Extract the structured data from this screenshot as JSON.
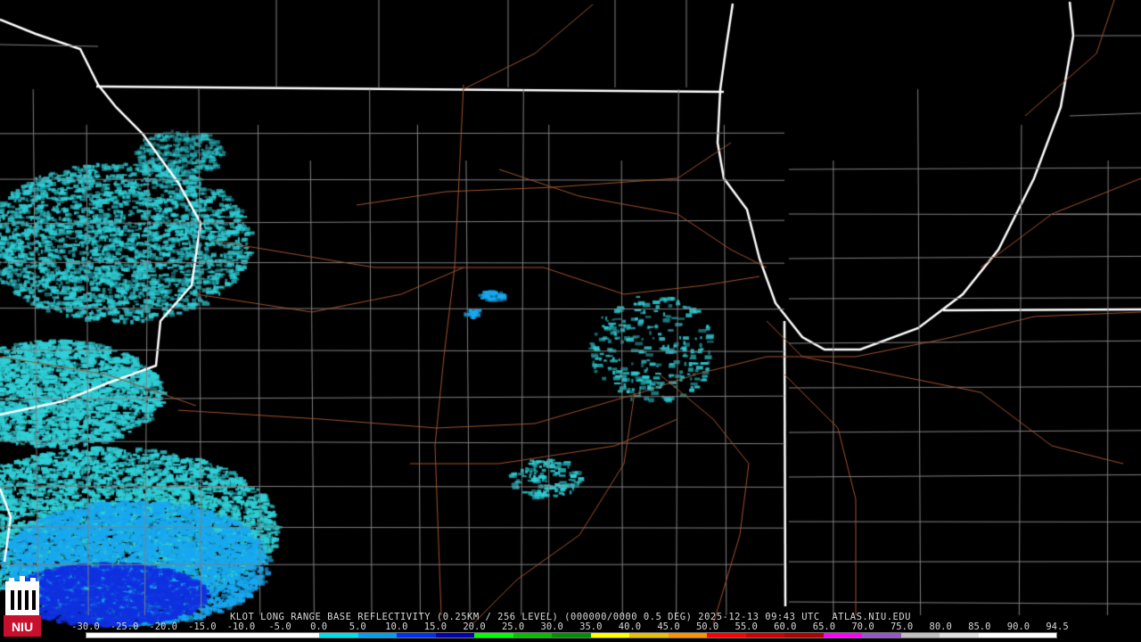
{
  "product": {
    "title_line": "KLOT LONG RANGE BASE REFLECTIVITY (0.25KM / 256 LEVEL) (000000/0000 0.5 DEG) 2025-12-13 09:43 UTC  ATLAS.NIU.EDU"
  },
  "colorbar": {
    "tick_labels": [
      "-30.0",
      "-25.0",
      "-20.0",
      "-15.0",
      "-10.0",
      "-5.0",
      "0.0",
      "5.0",
      "10.0",
      "15.0",
      "20.0",
      "25.0",
      "30.0",
      "35.0",
      "40.0",
      "45.0",
      "50.0",
      "55.0",
      "60.0",
      "65.0",
      "70.0",
      "75.0",
      "80.0",
      "85.0",
      "90.0",
      "94.5"
    ],
    "colors": [
      "#ffffff",
      "#ffffff",
      "#ffffff",
      "#ffffff",
      "#ffffff",
      "#ffffff",
      "#00e0e8",
      "#00a0f0",
      "#0030f0",
      "#0000b0",
      "#00ff00",
      "#00c000",
      "#009000",
      "#ffff00",
      "#e8c000",
      "#ff9000",
      "#ff0000",
      "#d00000",
      "#b00000",
      "#ff00ff",
      "#9955cc",
      "#c0c0c0",
      "#e0e0e0",
      "#ffffff",
      "#ffffff"
    ]
  },
  "logo": {
    "text": "NIU",
    "color": "#c8102e"
  },
  "map_colors": {
    "background": "#000000",
    "state_line": "#ffffff",
    "county_line": "#808080",
    "road": "#a0522d",
    "echo_light": "#30d0d8",
    "echo_mid": "#18a8f0",
    "echo_heavy": "#1030e0"
  }
}
